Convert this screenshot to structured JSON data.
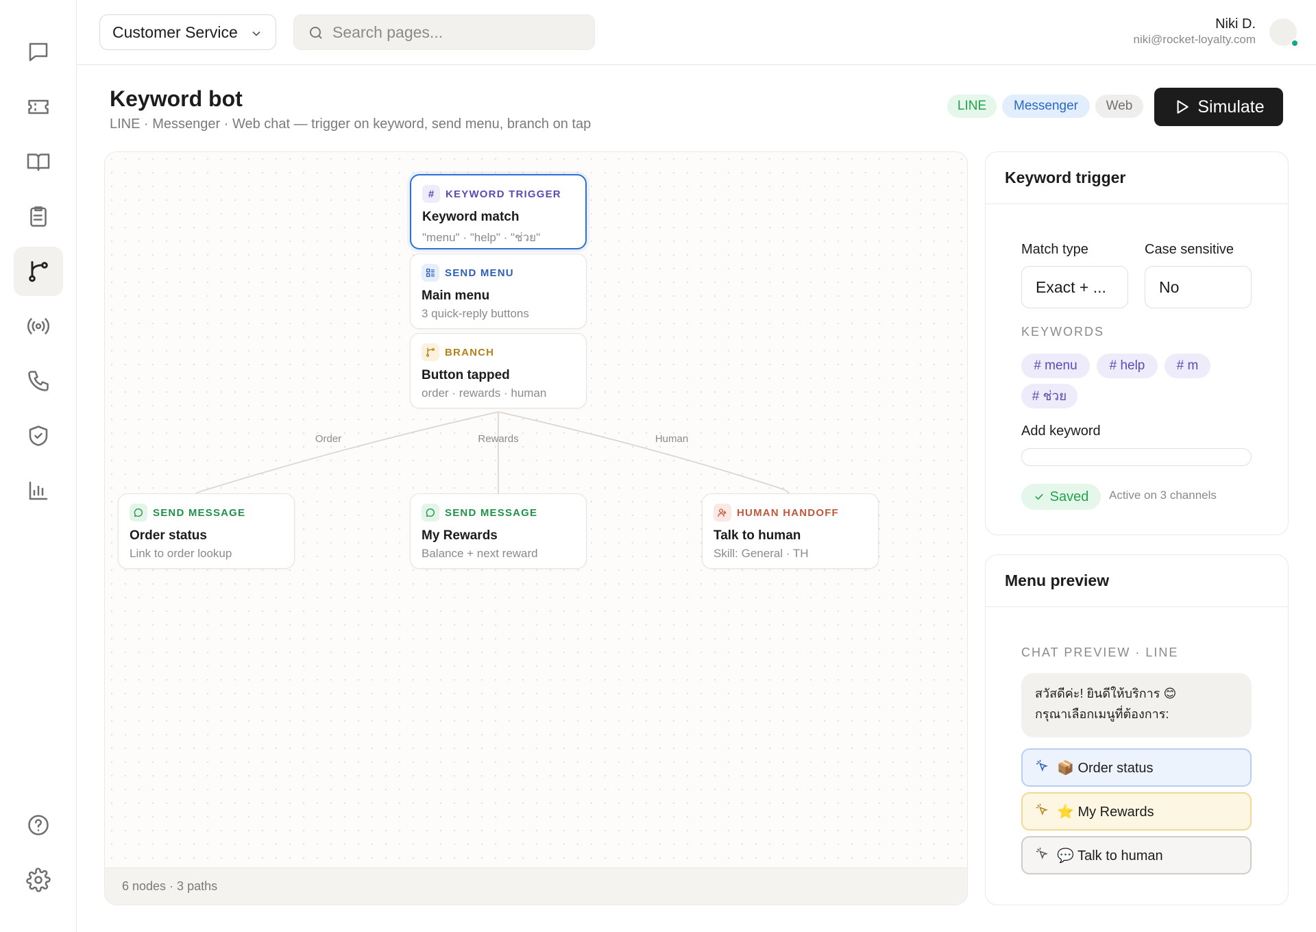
{
  "topbar": {
    "workspace": "Customer Service",
    "search_placeholder": "Search pages...",
    "user_name": "Niki D.",
    "user_email": "niki@rocket-loyalty.com"
  },
  "nav": {
    "items": [
      {
        "icon": "chat-icon"
      },
      {
        "icon": "ticket-icon"
      },
      {
        "icon": "book-icon"
      },
      {
        "icon": "clipboard-icon"
      },
      {
        "icon": "flow-branch-icon",
        "active": true
      },
      {
        "icon": "broadcast-icon"
      },
      {
        "icon": "phone-icon"
      },
      {
        "icon": "shield-check-icon"
      },
      {
        "icon": "bar-chart-icon"
      },
      {
        "icon": "help-circle-icon"
      },
      {
        "icon": "gear-icon"
      }
    ]
  },
  "page": {
    "title": "Keyword bot",
    "subtitle": "LINE · Messenger · Web chat — trigger on keyword, send menu, branch on tap",
    "channels": [
      "LINE",
      "Messenger",
      "Web"
    ],
    "simulate_label": "Simulate"
  },
  "flow": {
    "nodes": [
      {
        "type": "KEYWORD TRIGGER",
        "title": "Keyword match",
        "sub": "\"menu\" · \"help\" · \"ช่วย\"",
        "icon": "hash-icon",
        "selected": true
      },
      {
        "type": "SEND MENU",
        "title": "Main menu",
        "sub": "3 quick-reply buttons",
        "icon": "menu-grid-icon"
      },
      {
        "type": "BRANCH",
        "title": "Button tapped",
        "sub": "order · rewards · human",
        "icon": "branch-icon"
      },
      {
        "type": "SEND MESSAGE",
        "title": "Order status",
        "sub": "Link to order lookup",
        "icon": "message-icon"
      },
      {
        "type": "SEND MESSAGE",
        "title": "My Rewards",
        "sub": "Balance + next reward",
        "icon": "message-icon"
      },
      {
        "type": "HUMAN HANDOFF",
        "title": "Talk to human",
        "sub": "Skill: General · TH",
        "icon": "user-handoff-icon"
      }
    ],
    "edge_labels": [
      "Order",
      "Rewards",
      "Human"
    ],
    "footer": "6 nodes · 3 paths"
  },
  "inspector": {
    "title": "Keyword trigger",
    "match_type_label": "Match type",
    "match_type_value": "Exact + ...",
    "case_label": "Case sensitive",
    "case_value": "No",
    "keywords_label": "KEYWORDS",
    "keywords": [
      "# menu",
      "# help",
      "# m",
      "# ช่วย"
    ],
    "add_keyword_label": "Add keyword",
    "add_keyword_value": "",
    "saved_label": "Saved",
    "active_note": "Active on 3 channels"
  },
  "preview": {
    "title": "Menu preview",
    "caption": "CHAT PREVIEW · LINE",
    "bubble_line1": "สวัสดีค่ะ! ยินดีให้บริการ 😊",
    "bubble_line2": "กรุณาเลือกเมนูที่ต้องการ:",
    "quick_replies": [
      "📦 Order status",
      "⭐ My Rewards",
      "💬 Talk to human"
    ]
  },
  "colors": {
    "accent": "#1c1c1c",
    "selected_border": "#2a6fd6",
    "line_green": "#22a24c",
    "messenger_blue": "#2a68c8",
    "keyword_purple": "#5a4bb5"
  }
}
